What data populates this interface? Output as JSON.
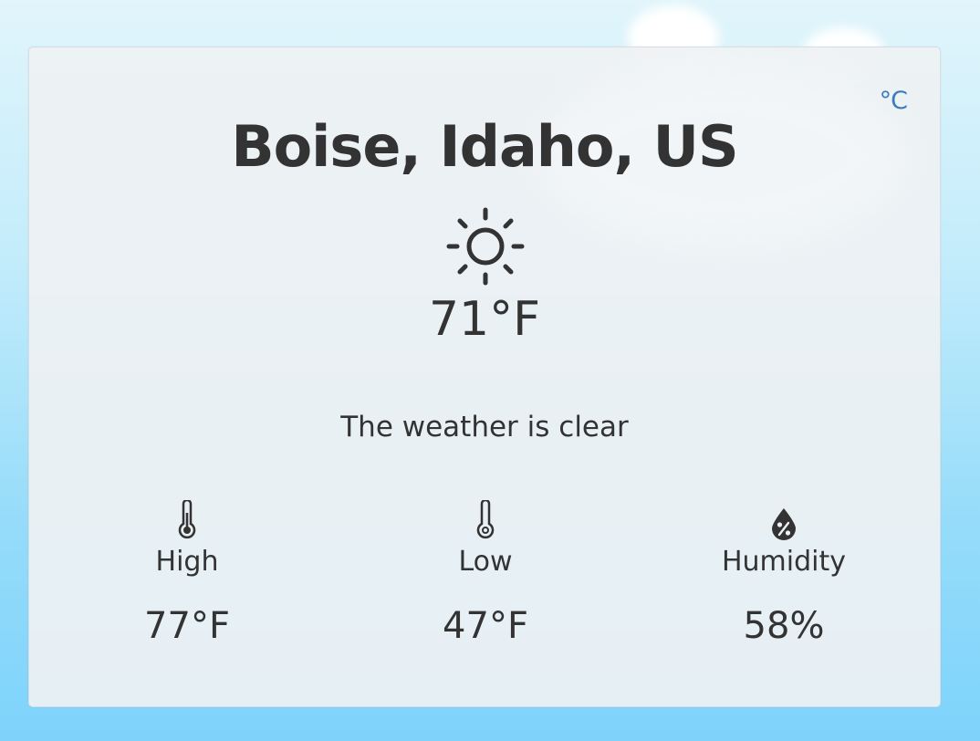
{
  "unit_toggle": "°C",
  "location": "Boise, Idaho, US",
  "current": {
    "icon": "sun-icon",
    "temperature": "71°F",
    "description": "The weather is clear"
  },
  "stats": [
    {
      "icon": "thermometer-icon",
      "label": "High",
      "value": "77°F"
    },
    {
      "icon": "thermometer-icon",
      "label": "Low",
      "value": "47°F"
    },
    {
      "icon": "humidity-drop-icon",
      "label": "Humidity",
      "value": "58%"
    }
  ],
  "colors": {
    "accent": "#3a7cbd",
    "text": "#333333",
    "card": "#eef1f3",
    "sky_top": "#e1f5fb",
    "sky_bottom": "#7ed3fb"
  }
}
